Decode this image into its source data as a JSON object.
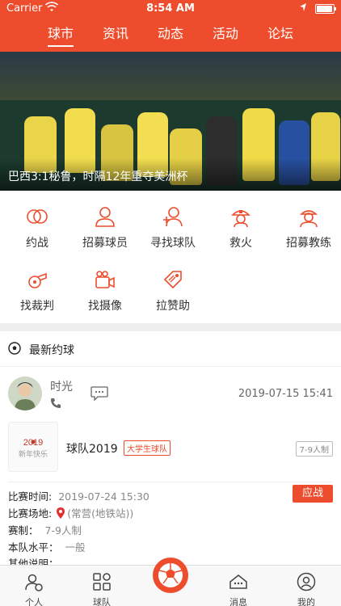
{
  "status_bar": {
    "carrier": "Carrier",
    "time": "8:54 AM"
  },
  "top_tabs": [
    "球市",
    "资讯",
    "动态",
    "活动",
    "论坛"
  ],
  "banner": {
    "caption": "巴西3:1秘鲁，时隔12年重夺美洲杯"
  },
  "quick_actions": [
    {
      "label": "约战",
      "icon": "rings-icon"
    },
    {
      "label": "招募球员",
      "icon": "person-icon"
    },
    {
      "label": "寻找球队",
      "icon": "person-add-icon"
    },
    {
      "label": "救火",
      "icon": "firefighter-icon"
    },
    {
      "label": "招募教练",
      "icon": "coach-icon"
    },
    {
      "label": "找裁判",
      "icon": "whistle-icon"
    },
    {
      "label": "找摄像",
      "icon": "camera-icon"
    },
    {
      "label": "拉赞助",
      "icon": "sponsor-tag-icon"
    }
  ],
  "latest": {
    "title": "最新约球",
    "post": {
      "user_name": "时光",
      "post_time": "2019-07-15 15:41",
      "team_name": "球队2019",
      "team_tag": "大学生球队",
      "format_badge": "7-9人制",
      "logo_text": "2019",
      "logo_subtext": "新年快乐",
      "accept_label": "应战",
      "fields": [
        {
          "label": "比赛时间:",
          "value": "2019-07-24 15:30"
        },
        {
          "label": "比赛场地:",
          "value": "(常营(地铁站))"
        },
        {
          "label": "赛制：",
          "value": "7-9人制"
        },
        {
          "label": "本队水平：",
          "value": "一般"
        },
        {
          "label": "其他说明：",
          "value": ""
        }
      ]
    }
  },
  "bottom_tabs": [
    {
      "label": "个人",
      "icon": "person-soccer-icon"
    },
    {
      "label": "球队",
      "icon": "team-grid-icon"
    },
    {
      "label": "",
      "icon": "soccer-ball-icon"
    },
    {
      "label": "消息",
      "icon": "message-icon"
    },
    {
      "label": "我的",
      "icon": "profile-icon"
    }
  ],
  "colors": {
    "accent": "#ee4d2d"
  }
}
